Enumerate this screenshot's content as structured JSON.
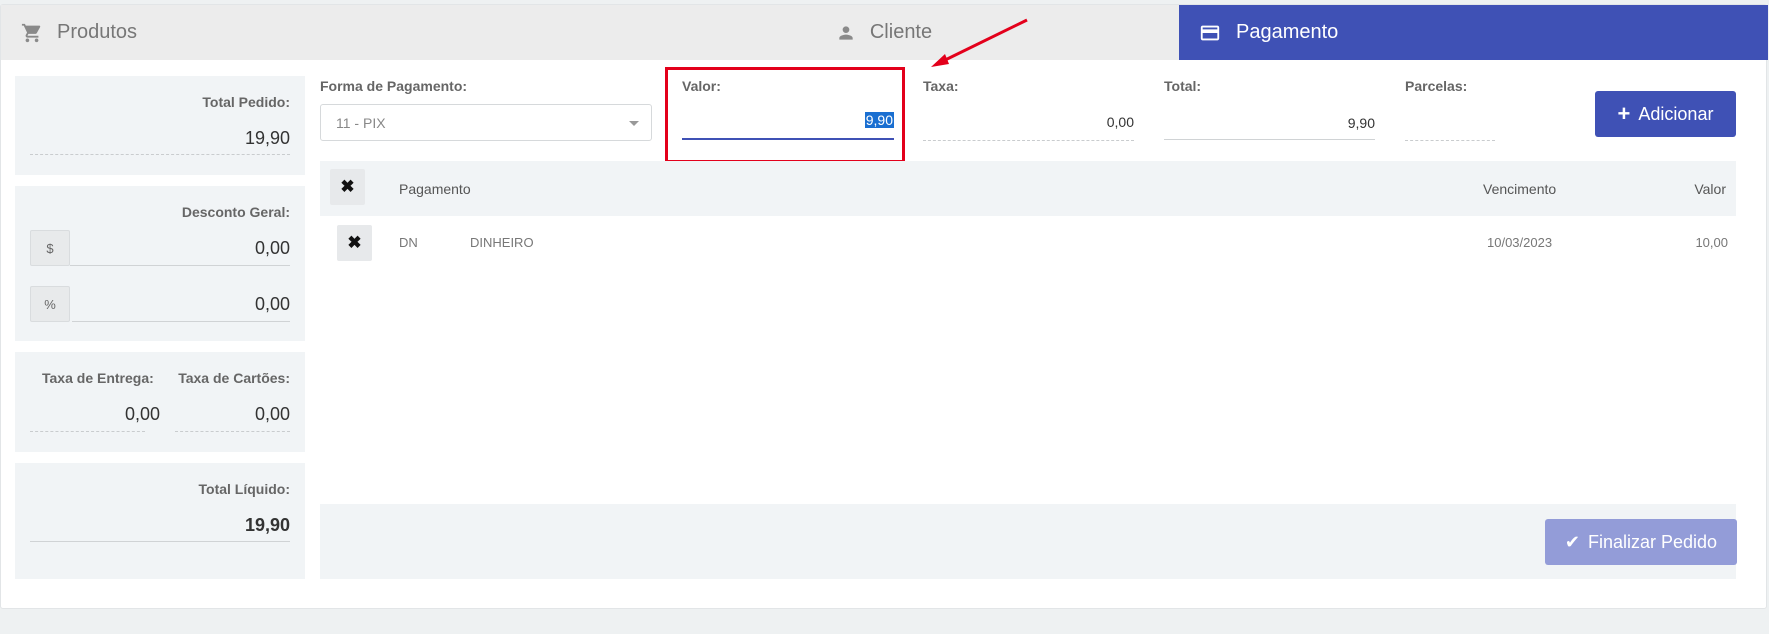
{
  "tabs": [
    {
      "label": "Produtos",
      "icon": "cart-icon"
    },
    {
      "label": "Cliente",
      "icon": "person-icon"
    },
    {
      "label": "Pagamento",
      "icon": "credit-card-icon",
      "active": true
    }
  ],
  "colors": {
    "primary": "#3f51b5",
    "highlight": "#e3001b",
    "panel": "#f1f4f6"
  },
  "summary": {
    "total_pedido_label": "Total Pedido:",
    "total_pedido_value": "19,90",
    "desconto_label": "Desconto Geral:",
    "desconto_currency_addon": "$",
    "desconto_currency_value": "0,00",
    "desconto_percent_addon": "%",
    "desconto_percent_value": "0,00",
    "taxa_entrega_label": "Taxa de Entrega:",
    "taxa_entrega_value": "0,00",
    "taxa_cartoes_label": "Taxa de Cartões:",
    "taxa_cartoes_value": "0,00",
    "total_liquido_label": "Total Líquido:",
    "total_liquido_value": "19,90"
  },
  "form": {
    "forma_label": "Forma de Pagamento:",
    "forma_selected": "11 - PIX",
    "valor_label": "Valor:",
    "valor_value": "9,90",
    "taxa_label": "Taxa:",
    "taxa_value": "0,00",
    "total_label": "Total:",
    "total_value": "9,90",
    "parcelas_label": "Parcelas:",
    "parcelas_value": "",
    "add_button": "Adicionar"
  },
  "table": {
    "headers": {
      "pagamento": "Pagamento",
      "vencimento": "Vencimento",
      "valor": "Valor"
    },
    "rows": [
      {
        "code": "DN",
        "name": "DINHEIRO",
        "vencimento": "10/03/2023",
        "valor": "10,00"
      }
    ]
  },
  "footer": {
    "finalizar_button": "Finalizar Pedido"
  }
}
